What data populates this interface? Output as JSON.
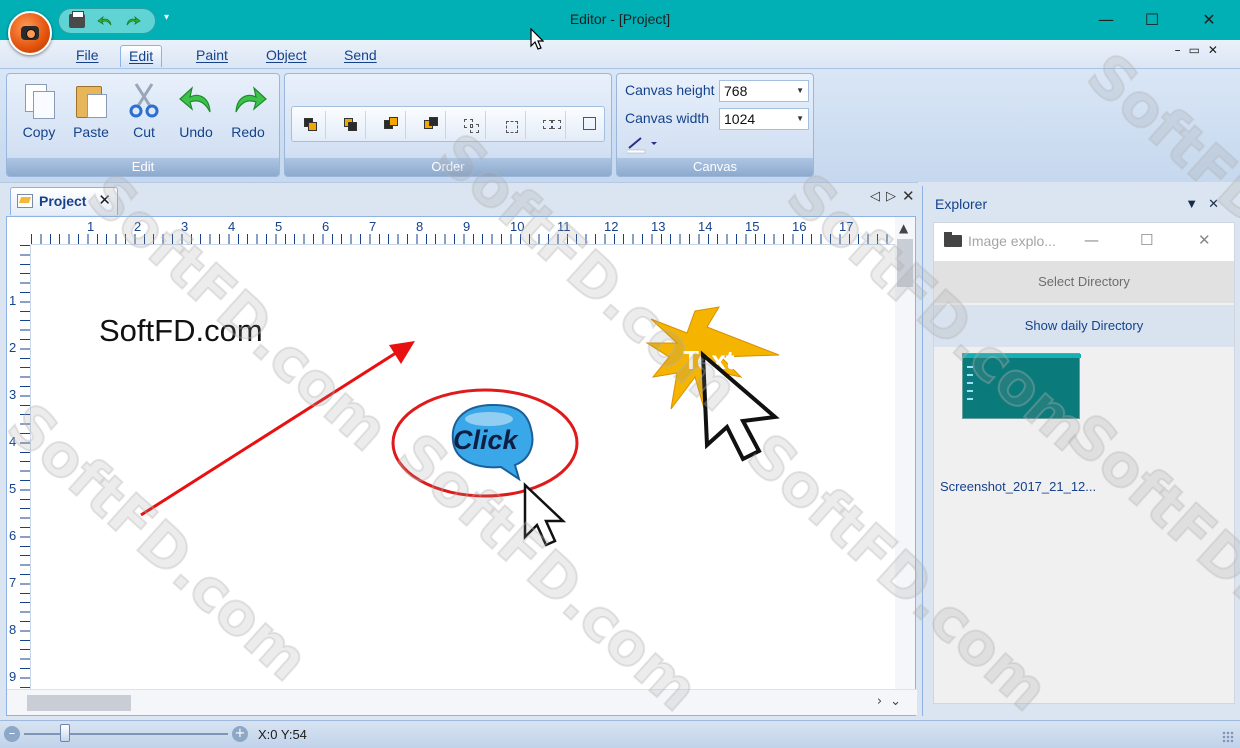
{
  "window": {
    "title": "Editor - [Project]"
  },
  "menu": {
    "items": [
      {
        "label": "File"
      },
      {
        "label": "Edit"
      },
      {
        "label": "Paint"
      },
      {
        "label": "Object"
      },
      {
        "label": "Send"
      }
    ]
  },
  "ribbon": {
    "edit_group": {
      "label": "Edit",
      "buttons": [
        {
          "label": "Copy",
          "icon": "copy-icon"
        },
        {
          "label": "Paste",
          "icon": "paste-icon"
        },
        {
          "label": "Cut",
          "icon": "scissors-icon"
        },
        {
          "label": "Undo",
          "icon": "undo-arrow-icon"
        },
        {
          "label": "Redo",
          "icon": "redo-arrow-icon"
        }
      ]
    },
    "order_group": {
      "label": "Order"
    },
    "canvas_group": {
      "label": "Canvas",
      "height_label": "Canvas height",
      "height_value": "768",
      "width_label": "Canvas width",
      "width_value": "1024"
    }
  },
  "document": {
    "tab_label": "Project",
    "canvas_text": "SoftFD.com",
    "bubble_text": "Click",
    "burst_text": "Text",
    "ruler_top": [
      "1",
      "2",
      "3",
      "4",
      "5",
      "6",
      "7",
      "8",
      "9",
      "10",
      "11",
      "12",
      "13",
      "14",
      "15",
      "16",
      "17"
    ],
    "ruler_left": [
      "1",
      "2",
      "3",
      "4",
      "5",
      "6",
      "7",
      "8",
      "9"
    ]
  },
  "explorer": {
    "title": "Explorer",
    "image_window_title": "Image explo...",
    "select_directory": "Select Directory",
    "show_daily_directory": "Show daily Directory",
    "thumbnail_name": "Screenshot_2017_21_12..."
  },
  "status": {
    "coordinates": "X:0 Y:54",
    "zoom_fraction": 0.2
  },
  "watermark": "SoftFD.com",
  "colors": {
    "titlebar": "#00b0b5",
    "accent_text": "#15428b",
    "arrow_red": "#e81010",
    "burst_gold": "#f5b400",
    "bubble_blue": "#3aa7e8"
  }
}
